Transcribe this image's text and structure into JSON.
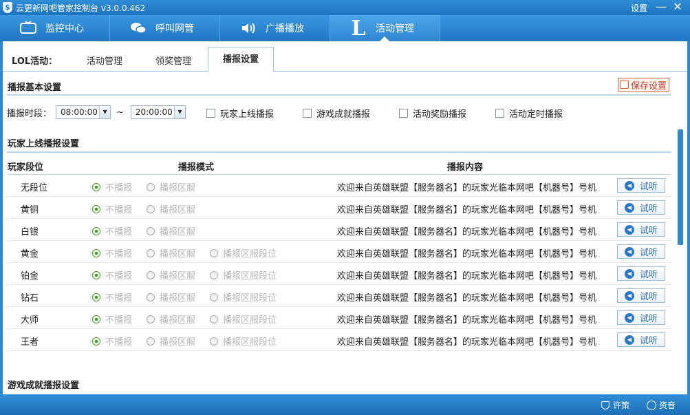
{
  "window": {
    "title": "云更新网吧管家控制台",
    "version": "v3.0.0.462",
    "settings_label": "设置",
    "minimize_label": "—",
    "close_label": "✕"
  },
  "nav": {
    "tabs": [
      {
        "label": "监控中心",
        "icon": "tv-icon"
      },
      {
        "label": "呼叫网管",
        "icon": "chat-icon"
      },
      {
        "label": "广播播放",
        "icon": "speaker-icon"
      },
      {
        "label": "活动管理",
        "icon": "lol-icon",
        "glyph": "L",
        "active": true
      }
    ]
  },
  "subtabs": {
    "lead": "LOL活动：",
    "items": [
      {
        "label": "活动管理"
      },
      {
        "label": "领奖管理"
      },
      {
        "label": "播报设置",
        "active": true
      }
    ]
  },
  "basic": {
    "title": "播报基本设置",
    "save_label": "保存设置",
    "time_label": "播报时段：",
    "start_time": "08:00:00",
    "end_time": "20:00:00",
    "tilde": "~",
    "checkboxes": [
      {
        "label": "玩家上线播报",
        "checked": false
      },
      {
        "label": "游戏成就播报",
        "checked": false
      },
      {
        "label": "活动奖励播报",
        "checked": false
      },
      {
        "label": "活动定时播报",
        "checked": false
      }
    ]
  },
  "online": {
    "title": "玩家上线播报设置",
    "headers": {
      "rank": "玩家段位",
      "mode": "播报模式",
      "content": "播报内容"
    },
    "mode_labels": [
      "不播报",
      "播报区服",
      "播报区服段位"
    ],
    "listen_label": "试听",
    "rows": [
      {
        "rank": "无段位",
        "msg": "欢迎来自英雄联盟【服务器名】的玩家光临本网吧【机器号】号机",
        "modes": 2
      },
      {
        "rank": "黄铜",
        "msg": "欢迎来自英雄联盟【服务器名】的玩家光临本网吧【机器号】号机",
        "modes": 2
      },
      {
        "rank": "白银",
        "msg": "欢迎来自英雄联盟【服务器名】的玩家光临本网吧【机器号】号机",
        "modes": 2
      },
      {
        "rank": "黄金",
        "msg": "欢迎来自英雄联盟【服务器名】的玩家光临本网吧【机器号】号机",
        "modes": 3
      },
      {
        "rank": "铂金",
        "msg": "欢迎来自英雄联盟【服务器名】的玩家光临本网吧【机器号】号机",
        "modes": 3
      },
      {
        "rank": "钻石",
        "msg": "欢迎来自英雄联盟【服务器名】的玩家光临本网吧【机器号】号机",
        "modes": 3
      },
      {
        "rank": "大师",
        "msg": "欢迎来自英雄联盟【服务器名】的玩家光临本网吧【机器号】号机",
        "modes": 3
      },
      {
        "rank": "王者",
        "msg": "欢迎来自英雄联盟【服务器名】的玩家光临本网吧【机器号】号机",
        "modes": 3
      }
    ]
  },
  "achievement": {
    "title": "游戏成就播报设置"
  },
  "status": {
    "left_label": "许策",
    "right_label": "资音"
  }
}
